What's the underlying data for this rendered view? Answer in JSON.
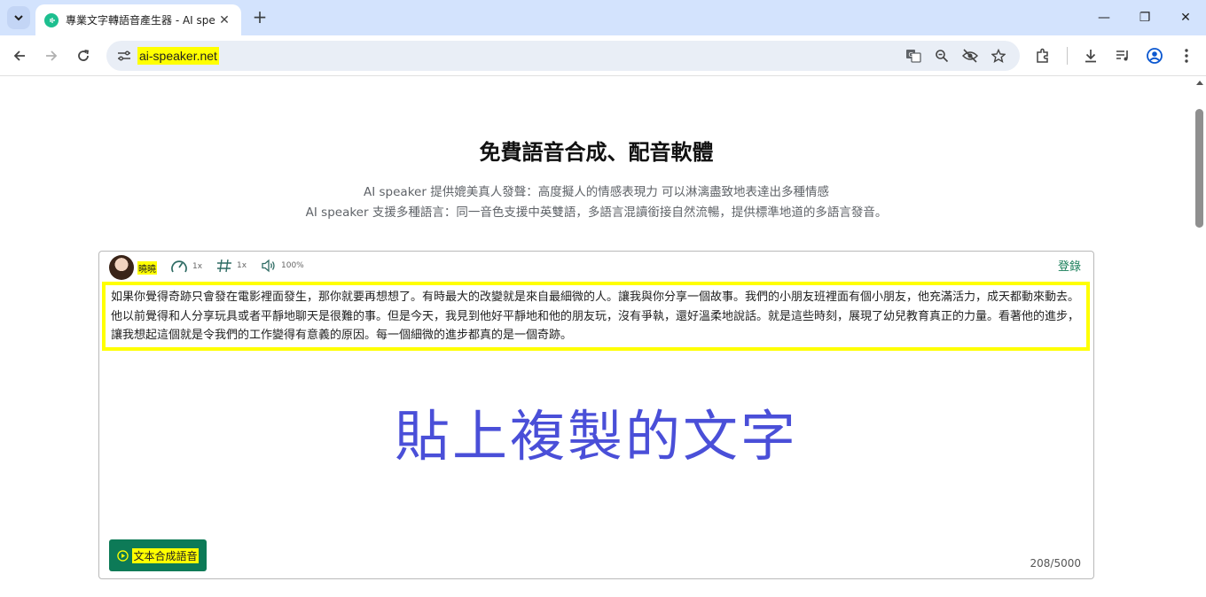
{
  "browser": {
    "tab_title": "專業文字轉語音產生器 - AI spe",
    "url": "ai-speaker.net",
    "close_symbol": "✕",
    "new_tab_symbol": "+",
    "window_controls": {
      "minimize": "—",
      "restore": "❐",
      "close": "✕"
    }
  },
  "page": {
    "title": "免費語音合成、配音軟體",
    "description_lines": [
      "AI speaker 提供媲美真人發聲：高度擬人的情感表現力 可以淋漓盡致地表達出多種情感",
      "AI speaker 支援多種語言：同一音色支援中英雙語，多語言混讀銜接自然流暢，提供標準地道的多語言發音。"
    ]
  },
  "editor": {
    "voice_name": "曉曉",
    "speed": "1x",
    "pitch": "1x",
    "volume": "100%",
    "login": "登錄",
    "text": "如果你覺得奇跡只會發在電影裡面發生，那你就要再想想了。有時最大的改變就是來自最細微的人。讓我與你分享一個故事。我們的小朋友班裡面有個小朋友，他充滿活力，成天都動來動去。他以前覺得和人分享玩具或者平靜地聊天是很難的事。但是今天，我見到他好平靜地和他的朋友玩，沒有爭執，還好溫柔地說話。就是這些時刻，展現了幼兒教育真正的力量。看著他的進步，讓我想起這個就是令我們的工作變得有意義的原因。每一個細微的進步都真的是一個奇跡。",
    "overlay_text": "貼上複製的文字",
    "synth_button": "文本合成語音",
    "char_count": "208/5000"
  },
  "colors": {
    "highlight": "#ffff00",
    "accent": "#0d7a57",
    "overlay_text": "#4a4fd8"
  }
}
